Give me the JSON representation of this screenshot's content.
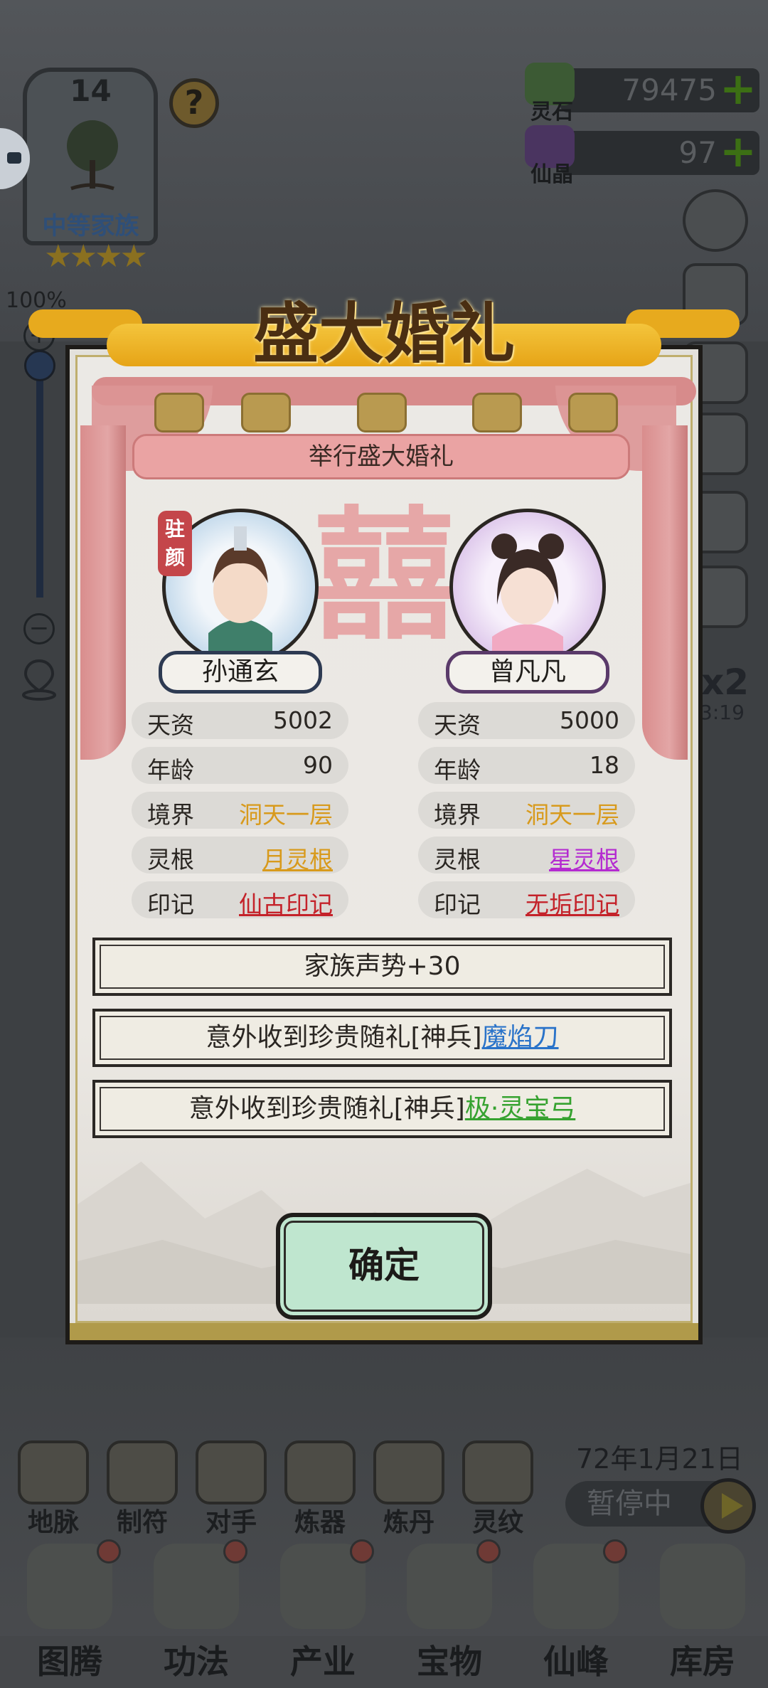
{
  "clan": {
    "level": "14",
    "name": "中等家族",
    "stars": "★★★★",
    "help_icon": "?"
  },
  "zoom": {
    "percent": "100%",
    "plus": "+",
    "minus": "−"
  },
  "resources": [
    {
      "label": "灵石",
      "value": "79475",
      "plus": "+",
      "icon": "spirit-stone-icon",
      "color": "#3c5a34"
    },
    {
      "label": "仙晶",
      "value": "97",
      "plus": "+",
      "icon": "immortal-crystal-icon",
      "color": "#4a3460"
    }
  ],
  "speed": {
    "label": "x2",
    "time": "3:19"
  },
  "dialog": {
    "title": "盛大婚礼",
    "subtitle": "举行盛大婚礼",
    "xi": "囍",
    "left": {
      "name": "孙通玄",
      "stamp": "驻颜",
      "stats": [
        {
          "label": "天资",
          "value": "5002",
          "style": ""
        },
        {
          "label": "年龄",
          "value": "90",
          "style": ""
        },
        {
          "label": "境界",
          "value": "洞天一层",
          "style": "c-gold"
        },
        {
          "label": "灵根",
          "value": "月灵根",
          "style": "c-gold-u"
        },
        {
          "label": "印记",
          "value": "仙古印记",
          "style": "c-red-u"
        }
      ]
    },
    "right": {
      "name": "曾凡凡",
      "stats": [
        {
          "label": "天资",
          "value": "5000",
          "style": ""
        },
        {
          "label": "年龄",
          "value": "18",
          "style": ""
        },
        {
          "label": "境界",
          "value": "洞天一层",
          "style": "c-gold"
        },
        {
          "label": "灵根",
          "value": "星灵根",
          "style": "c-purple-u"
        },
        {
          "label": "印记",
          "value": "无垢印记",
          "style": "c-red-u"
        }
      ]
    },
    "rewards": [
      {
        "text": "家族声势+30",
        "item": "",
        "item_style": ""
      },
      {
        "text": "意外收到珍贵随礼[神兵]",
        "item": "魔焰刀",
        "item_style": "c-blue-u"
      },
      {
        "text": "意外收到珍贵随礼[神兵]",
        "item": "极·灵宝弓",
        "item_style": "c-green-u"
      }
    ],
    "confirm": "确定"
  },
  "game_date": "72年1月21日",
  "pause_label": "暂停中",
  "mid_menu": [
    "地脉",
    "制符",
    "对手",
    "炼器",
    "炼丹",
    "灵纹"
  ],
  "bottom_nav": [
    "图腾",
    "功法",
    "产业",
    "宝物",
    "仙峰",
    "库房"
  ]
}
